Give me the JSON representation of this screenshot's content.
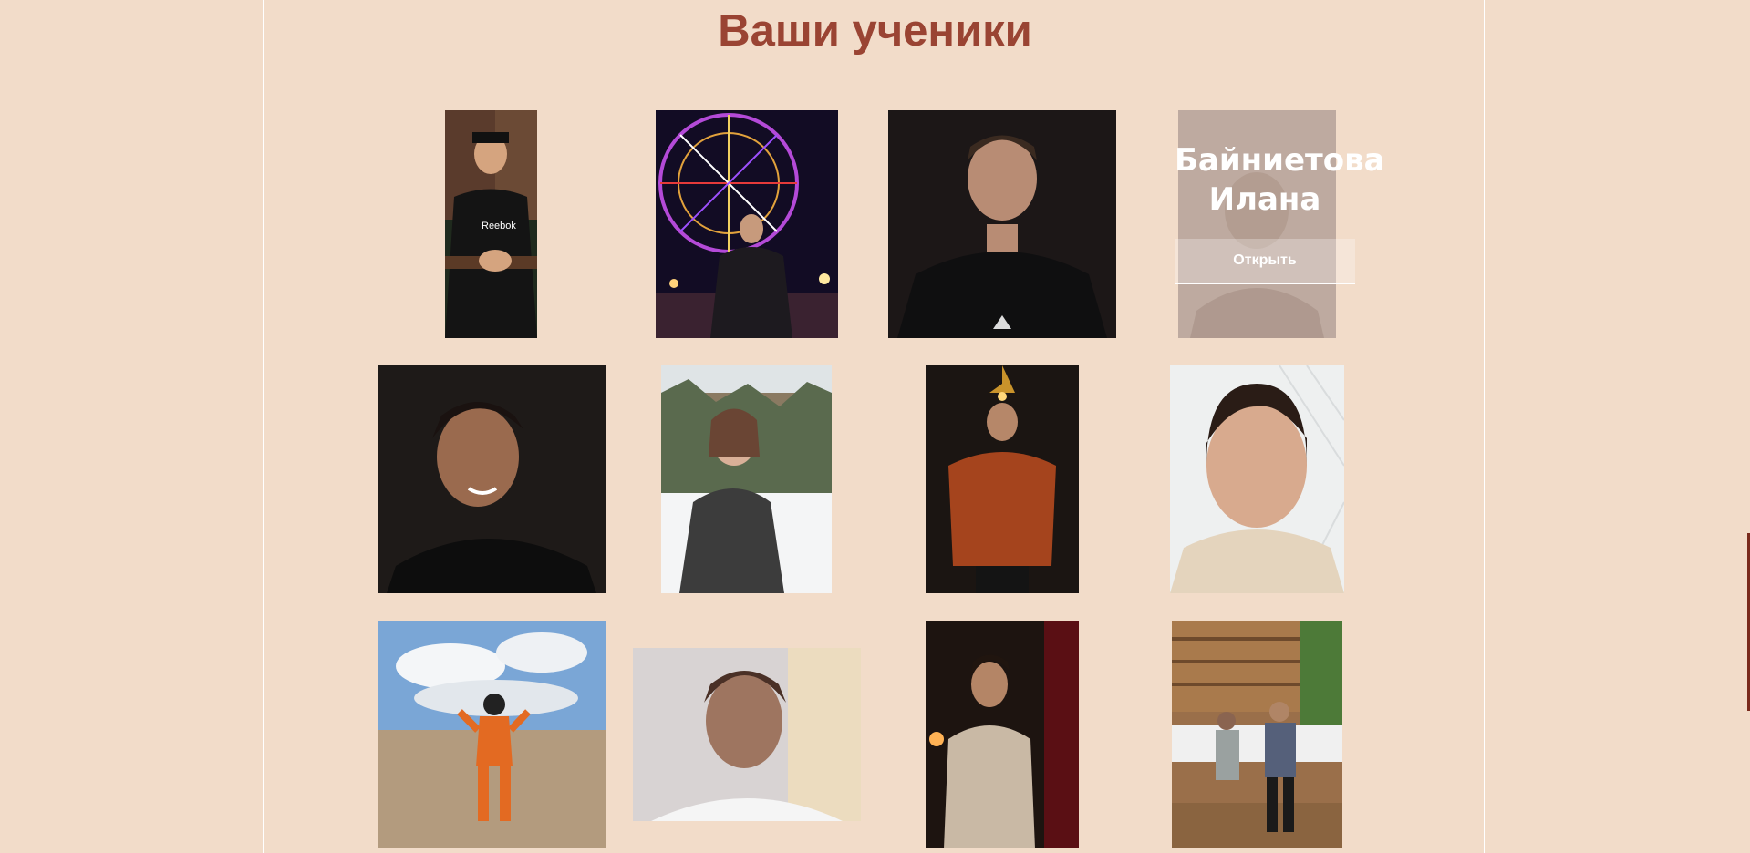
{
  "page": {
    "title": "Ваши ученики",
    "background_color": "#f2dcc9",
    "title_color": "#9a4433"
  },
  "students": [
    {
      "photo": "student-photo-1",
      "subject": "young man in cap and black Reebok t-shirt leaning on railing near tree"
    },
    {
      "photo": "student-photo-2",
      "subject": "girl in front of illuminated Ferris wheel at night"
    },
    {
      "photo": "student-photo-3",
      "subject": "young man in black jacket, dark background"
    },
    {
      "photo": "student-photo-4",
      "subject": "portrait, hovered card",
      "name": "Байниетова Илана",
      "button_label": "Открыть"
    },
    {
      "photo": "student-photo-5",
      "subject": "smiling young man in black hoodie"
    },
    {
      "photo": "student-photo-6",
      "subject": "girl with glasses sitting in snow, forest behind"
    },
    {
      "photo": "student-photo-7",
      "subject": "young man in rust turtleneck under hanging lamp"
    },
    {
      "photo": "student-photo-8",
      "subject": "girl selfie, light background"
    },
    {
      "photo": "student-photo-9",
      "subject": "motocross rider in orange gear under cloudy sky"
    },
    {
      "photo": "student-photo-10",
      "subject": "young man in white t-shirt, close-up"
    },
    {
      "photo": "student-photo-11",
      "subject": "young man in beige t-shirt by red curtain"
    },
    {
      "photo": "student-photo-12",
      "subject": "two people seated in wooden gazebo"
    }
  ]
}
